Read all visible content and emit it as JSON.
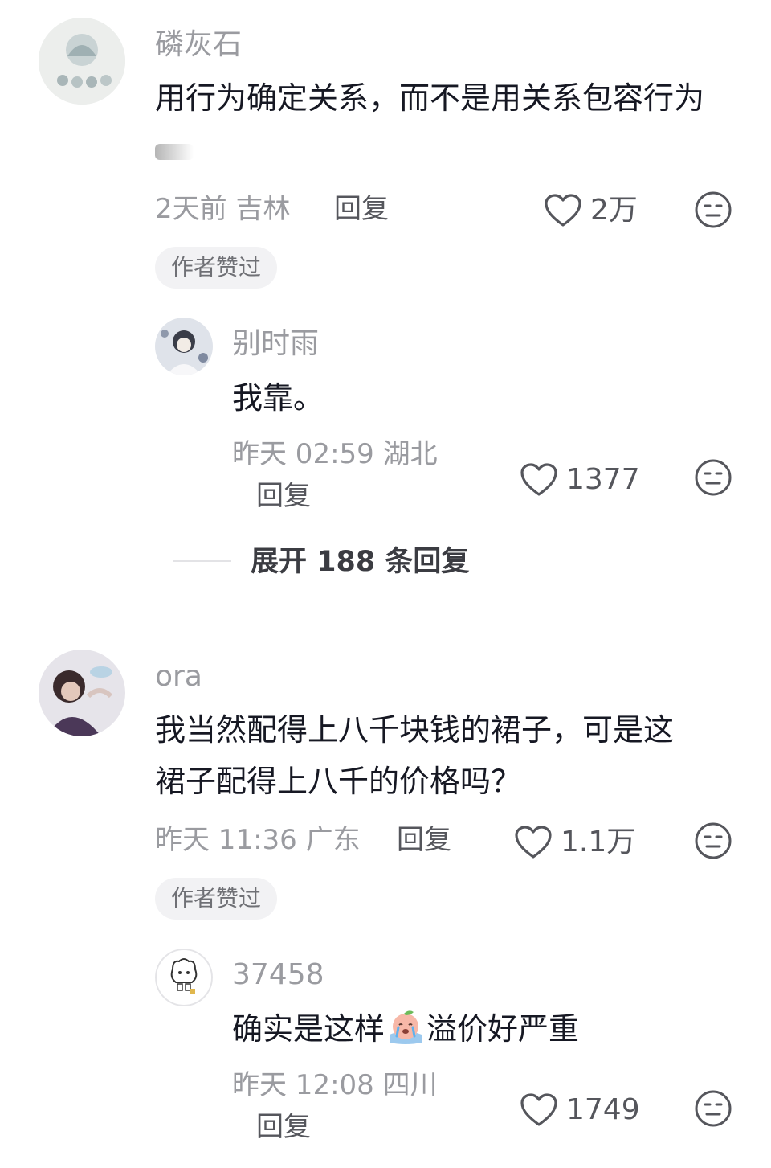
{
  "comments": [
    {
      "author": "磷灰石",
      "text": "用行为确定关系，而不是用关系包容行为",
      "time_location": "2天前 吉林",
      "reply_label": "回复",
      "likes": "2万",
      "badge": "作者赞过",
      "replies": [
        {
          "author": "别时雨",
          "text": "我靠。",
          "time_location": "昨天 02:59 湖北",
          "reply_label": "回复",
          "likes": "1377"
        }
      ],
      "expand_label": "展开 188 条回复"
    },
    {
      "author": "ora",
      "text_line1": "我当然配得上八千块钱的裙子，可是这",
      "text_line2": "裙子配得上八千的价格吗？",
      "time_location": "昨天 11:36 广东",
      "reply_label": "回复",
      "likes": "1.1万",
      "badge": "作者赞过",
      "replies": [
        {
          "author": "37458",
          "text_before": "确实是这样",
          "text_after": "溢价好严重",
          "time_location": "昨天 12:08 四川",
          "reply_label": "回复",
          "likes": "1749"
        }
      ]
    }
  ],
  "colors": {
    "name": "#9a9ba0",
    "text": "#161823",
    "secondary": "#55565c"
  },
  "icons": {
    "like": "heart-outline-icon",
    "dislike": "neutral-face-icon"
  }
}
